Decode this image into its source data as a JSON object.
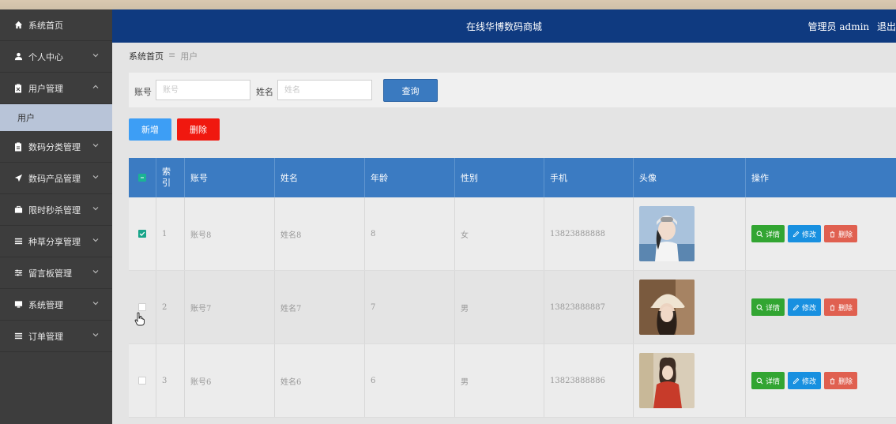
{
  "sidebar": {
    "items": [
      {
        "label": "系统首页",
        "icon": "home-icon"
      },
      {
        "label": "个人中心",
        "icon": "user-icon"
      },
      {
        "label": "用户管理",
        "icon": "clipboard-icon"
      },
      {
        "label": "数码分类管理",
        "icon": "clipboard-icon"
      },
      {
        "label": "数码产品管理",
        "icon": "send-icon"
      },
      {
        "label": "限时秒杀管理",
        "icon": "briefcase-icon"
      },
      {
        "label": "种草分享管理",
        "icon": "list-icon"
      },
      {
        "label": "留言板管理",
        "icon": "sliders-icon"
      },
      {
        "label": "系统管理",
        "icon": "monitor-icon"
      },
      {
        "label": "订单管理",
        "icon": "list-icon"
      }
    ],
    "sub_item": "用户"
  },
  "header": {
    "title": "在线华博数码商城",
    "user_text": "管理员 admin",
    "logout": "退出"
  },
  "breadcrumb": {
    "home": "系统首页",
    "current": "用户"
  },
  "search": {
    "account_label": "账号",
    "account_placeholder": "账号",
    "name_label": "姓名",
    "name_placeholder": "姓名",
    "query_button": "查询"
  },
  "actions": {
    "add": "新增",
    "delete": "删除"
  },
  "table": {
    "headers": [
      "索引",
      "账号",
      "姓名",
      "年龄",
      "性别",
      "手机",
      "头像",
      "操作"
    ],
    "rows": [
      {
        "index": "1",
        "account": "账号8",
        "name": "姓名8",
        "age": "8",
        "gender": "女",
        "phone": "13823888888",
        "checked": true
      },
      {
        "index": "2",
        "account": "账号7",
        "name": "姓名7",
        "age": "7",
        "gender": "男",
        "phone": "13823888887",
        "checked": false
      },
      {
        "index": "3",
        "account": "账号6",
        "name": "姓名6",
        "age": "6",
        "gender": "男",
        "phone": "13823888886",
        "checked": false
      }
    ],
    "op_detail": "详情",
    "op_edit": "修改",
    "op_delete": "删除"
  },
  "colors": {
    "header_bg": "#0f3a80",
    "sidebar_bg": "#3d3d3d",
    "table_header_bg": "#3b7bc2",
    "add_button": "#3d9ef5",
    "delete_button": "#f0180f",
    "detail_button": "#32a532",
    "edit_button": "#1890e0",
    "remove_button": "#e06050"
  }
}
